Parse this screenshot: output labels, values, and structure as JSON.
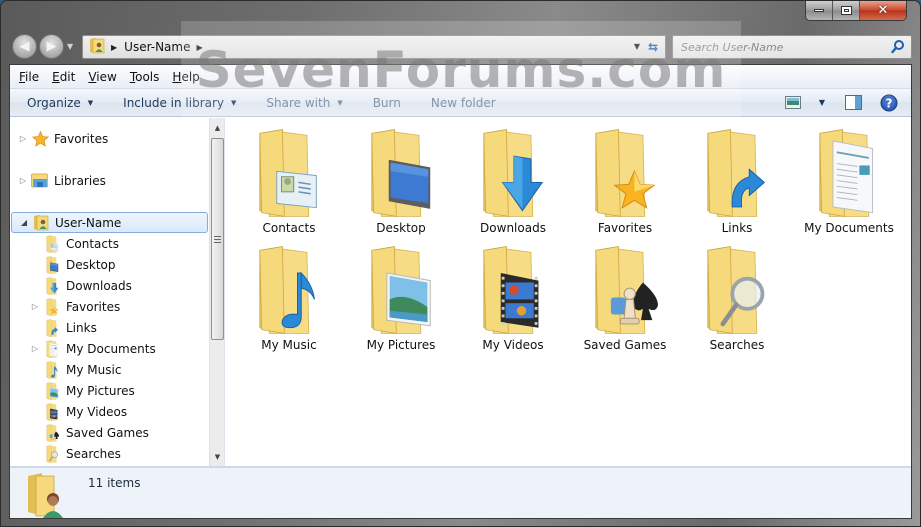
{
  "window": {
    "caption_buttons": {
      "minimize": "minimize",
      "maximize": "maximize",
      "close": "close"
    }
  },
  "navigation": {
    "back_label": "Back",
    "forward_label": "Forward",
    "address": {
      "crumbs": [
        "User-Name"
      ]
    },
    "search": {
      "placeholder": "Search User-Name"
    }
  },
  "menubar": {
    "items": [
      {
        "label": "File",
        "accel": "F",
        "rest": "ile"
      },
      {
        "label": "Edit",
        "accel": "E",
        "rest": "dit"
      },
      {
        "label": "View",
        "accel": "V",
        "rest": "iew"
      },
      {
        "label": "Tools",
        "accel": "T",
        "rest": "ools"
      },
      {
        "label": "Help",
        "accel": "H",
        "rest": "elp"
      }
    ]
  },
  "commandbar": {
    "organize": "Organize",
    "include_in_library": "Include in library",
    "share_with": "Share with",
    "burn": "Burn",
    "new_folder": "New folder"
  },
  "tree": {
    "favorites": "Favorites",
    "libraries": "Libraries",
    "user": "User-Name",
    "children": [
      {
        "label": "Contacts",
        "expandable": false,
        "icon": "contacts"
      },
      {
        "label": "Desktop",
        "expandable": false,
        "icon": "desktop"
      },
      {
        "label": "Downloads",
        "expandable": false,
        "icon": "downloads"
      },
      {
        "label": "Favorites",
        "expandable": true,
        "icon": "favorites"
      },
      {
        "label": "Links",
        "expandable": false,
        "icon": "links"
      },
      {
        "label": "My Documents",
        "expandable": true,
        "icon": "documents"
      },
      {
        "label": "My Music",
        "expandable": false,
        "icon": "music"
      },
      {
        "label": "My Pictures",
        "expandable": false,
        "icon": "pictures"
      },
      {
        "label": "My Videos",
        "expandable": false,
        "icon": "videos"
      },
      {
        "label": "Saved Games",
        "expandable": false,
        "icon": "games"
      },
      {
        "label": "Searches",
        "expandable": false,
        "icon": "searches"
      }
    ]
  },
  "content": {
    "items": [
      {
        "label": "Contacts",
        "icon": "contacts"
      },
      {
        "label": "Desktop",
        "icon": "desktop"
      },
      {
        "label": "Downloads",
        "icon": "downloads"
      },
      {
        "label": "Favorites",
        "icon": "favorites"
      },
      {
        "label": "Links",
        "icon": "links"
      },
      {
        "label": "My Documents",
        "icon": "documents"
      },
      {
        "label": "My Music",
        "icon": "music"
      },
      {
        "label": "My Pictures",
        "icon": "pictures"
      },
      {
        "label": "My Videos",
        "icon": "videos"
      },
      {
        "label": "Saved Games",
        "icon": "games"
      },
      {
        "label": "Searches",
        "icon": "searches"
      }
    ]
  },
  "details": {
    "item_count": "11 items"
  },
  "watermark": {
    "text": "SevenForums.com"
  },
  "colors": {
    "folder": "#f5d97a",
    "folder_dark": "#e3be55",
    "accent_blue": "#2a8ad8",
    "selection_border": "#84acdd",
    "command_text": "#1e395b"
  }
}
